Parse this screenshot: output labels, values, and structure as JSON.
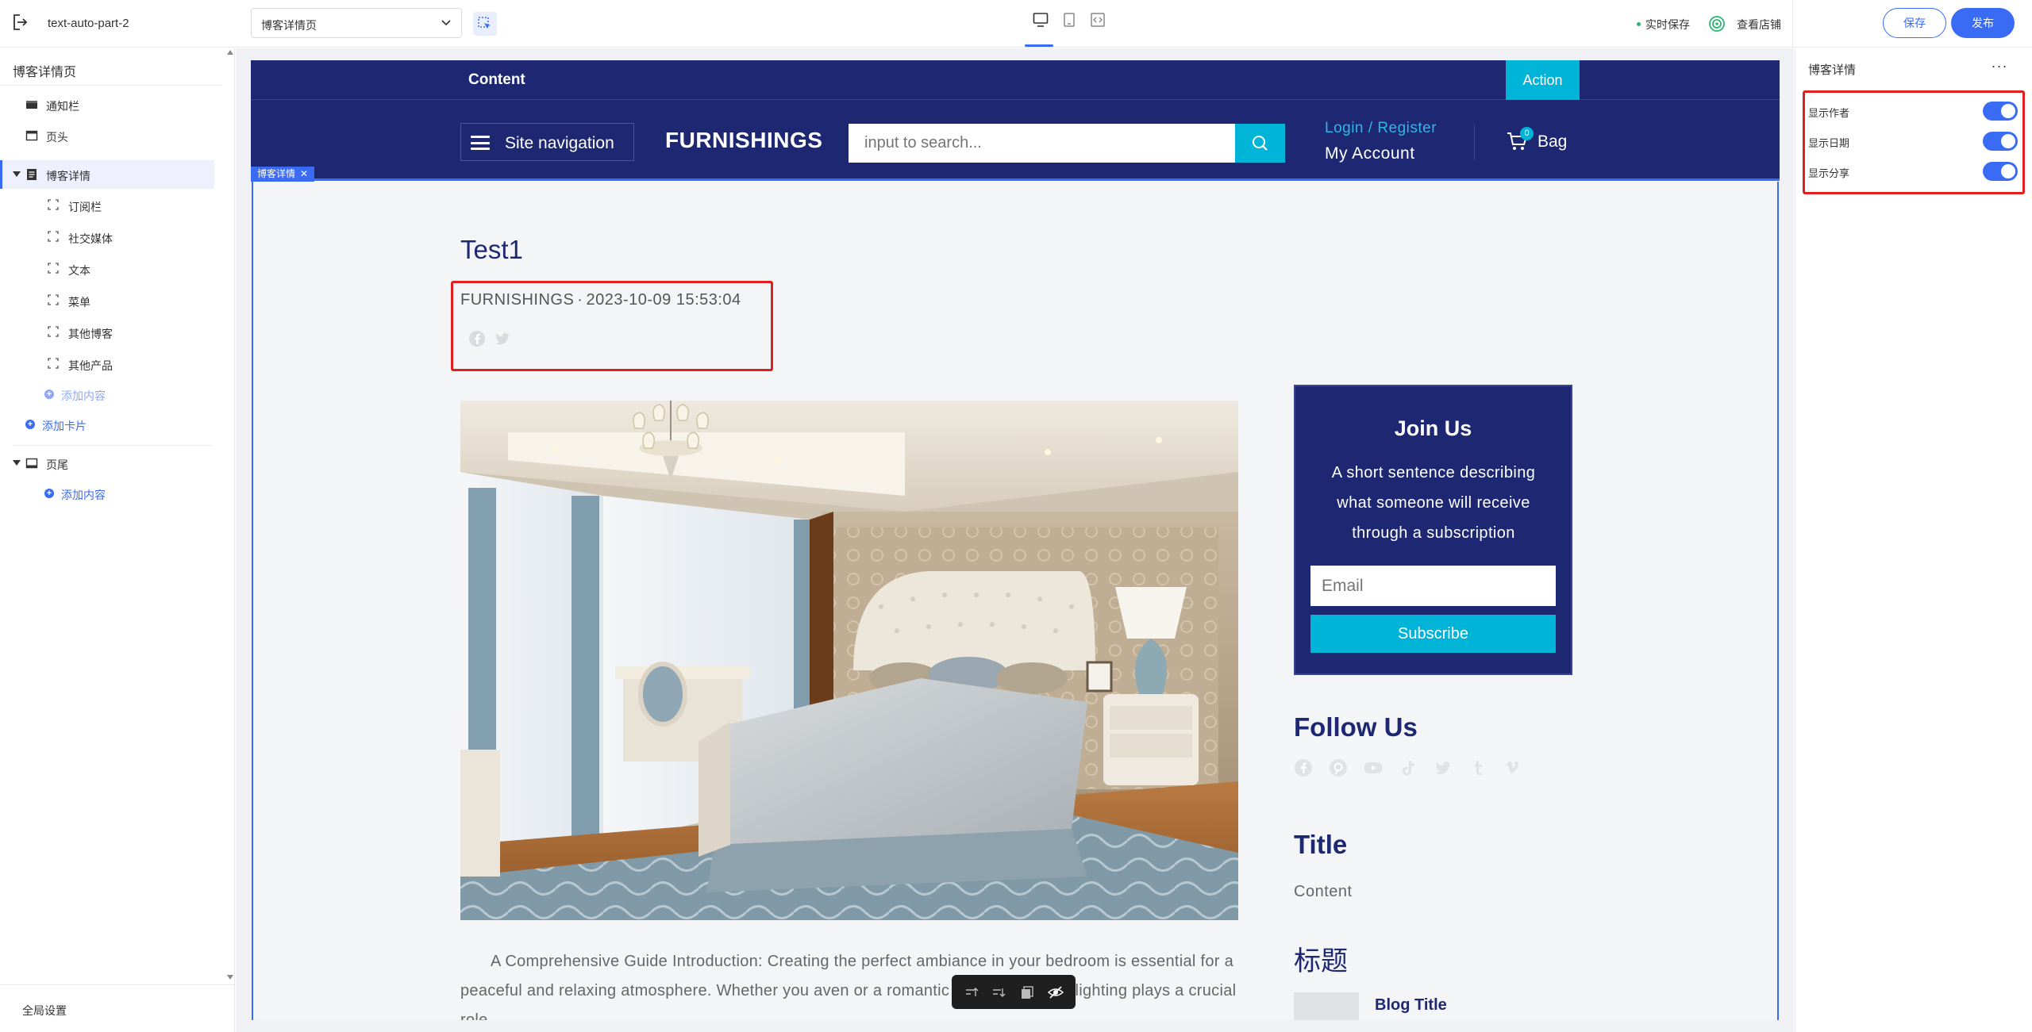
{
  "topbar": {
    "project_name": "text-auto-part-2",
    "page_select_value": "博客详情页",
    "autosave_label": "实时保存",
    "view_store_label": "查看店铺",
    "save_label": "保存",
    "publish_label": "发布"
  },
  "left_panel": {
    "title": "博客详情页",
    "items": [
      {
        "label": "通知栏",
        "icon": "notification-bar-icon"
      },
      {
        "label": "页头",
        "icon": "header-icon"
      },
      {
        "label": "博客详情",
        "icon": "blog-detail-icon"
      },
      {
        "label": "订阅栏",
        "icon": "section-icon"
      },
      {
        "label": "社交媒体",
        "icon": "section-icon"
      },
      {
        "label": "文本",
        "icon": "section-icon"
      },
      {
        "label": "菜单",
        "icon": "section-icon"
      },
      {
        "label": "其他博客",
        "icon": "section-icon"
      },
      {
        "label": "其他产品",
        "icon": "section-icon"
      },
      {
        "label": "添加内容",
        "icon": "plus-icon"
      },
      {
        "label": "添加卡片",
        "icon": "plus-icon"
      },
      {
        "label": "页尾",
        "icon": "footer-icon"
      },
      {
        "label": "添加内容",
        "icon": "plus-icon"
      }
    ],
    "global_settings": "全局设置"
  },
  "preview": {
    "announcement": {
      "content": "Content",
      "action": "Action"
    },
    "header": {
      "site_navigation": "Site navigation",
      "brand": "FURNISHINGS",
      "search_placeholder": "input to search...",
      "login": "Login / Register",
      "account": "My Account",
      "bag_label": "Bag",
      "bag_count": "0"
    },
    "section_tag": "博客详情",
    "post": {
      "title": "Test1",
      "author": "FURNISHINGS",
      "separator": "·",
      "date": "2023-10-09 15:53:04",
      "share_icons": [
        "facebook-icon",
        "twitter-icon"
      ],
      "body_visible_1": "A Comprehensive Guide Introduction: Creating the perfect ambiance in your bedroom is essential for a peaceful and relaxing atmosphere. Whether you",
      "body_visible_2": "aven or a romantic retreat, the right lighting plays a crucial role."
    },
    "sidebar": {
      "join_title": "Join Us",
      "join_desc": "A short sentence describing what someone will receive through a subscription",
      "email_placeholder": "Email",
      "subscribe": "Subscribe",
      "follow_title": "Follow Us",
      "follow_icons": [
        "facebook-icon",
        "pinterest-icon",
        "youtube-icon",
        "tiktok-icon",
        "twitter-icon",
        "tumblr-icon",
        "vimeo-icon"
      ],
      "title": "Title",
      "content": "Content",
      "heading_cn": "标题",
      "blog_title": "Blog Title"
    }
  },
  "right_panel": {
    "title": "博客详情",
    "toggles": [
      {
        "label": "显示作者",
        "on": true
      },
      {
        "label": "显示日期",
        "on": true
      },
      {
        "label": "显示分享",
        "on": true
      }
    ]
  },
  "colors": {
    "accent": "#3a6bf5",
    "navy": "#1e2872",
    "cyan": "#00b4d8",
    "highlight_red": "#e02020"
  }
}
